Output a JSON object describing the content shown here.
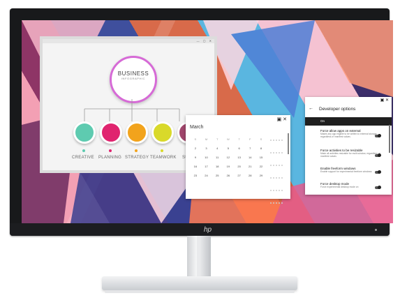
{
  "infographic": {
    "title": "BUSINESS",
    "subtitle": "INFOGRAPHIC",
    "items": [
      {
        "label": "CREATIVE",
        "color": "#5ecbb0"
      },
      {
        "label": "PLANNING",
        "color": "#e0246f"
      },
      {
        "label": "STRATEGY",
        "color": "#f2a31c"
      },
      {
        "label": "TEAMWORK",
        "color": "#d9d92a"
      },
      {
        "label": "SUCC",
        "color": "#a0466c"
      }
    ]
  },
  "calendar": {
    "month": "March",
    "weekdays": [
      "S",
      "M",
      "T",
      "W",
      "T",
      "F",
      "S"
    ],
    "weeks": [
      [
        "",
        "",
        "",
        "",
        "",
        "",
        ""
      ],
      [
        "2",
        "3",
        "4",
        "5",
        "6",
        "7",
        "8"
      ],
      [
        "9",
        "10",
        "11",
        "12",
        "13",
        "14",
        "15"
      ],
      [
        "16",
        "17",
        "18",
        "19",
        "20",
        "21",
        "22"
      ],
      [
        "23",
        "24",
        "25",
        "26",
        "27",
        "28",
        "29"
      ],
      [
        "",
        "",
        "",
        "",
        "",
        "",
        ""
      ]
    ],
    "ctrl_icons": "▣ ✕"
  },
  "developer": {
    "title": "Developer options",
    "status": "On",
    "items": [
      {
        "title": "Force allow apps on external",
        "desc": "Makes any app eligible to be written to external storage, regardless of manifest values"
      },
      {
        "title": "Force activities to be resizable",
        "desc": "Make all activities resizable for multi-window, regardless of manifest values"
      },
      {
        "title": "Enable freeform windows",
        "desc": "Enable support for experimental freeform windows"
      },
      {
        "title": "Force desktop mode",
        "desc": "Force experimental desktop mode on"
      }
    ]
  },
  "monitor": {
    "logo": "hp"
  }
}
